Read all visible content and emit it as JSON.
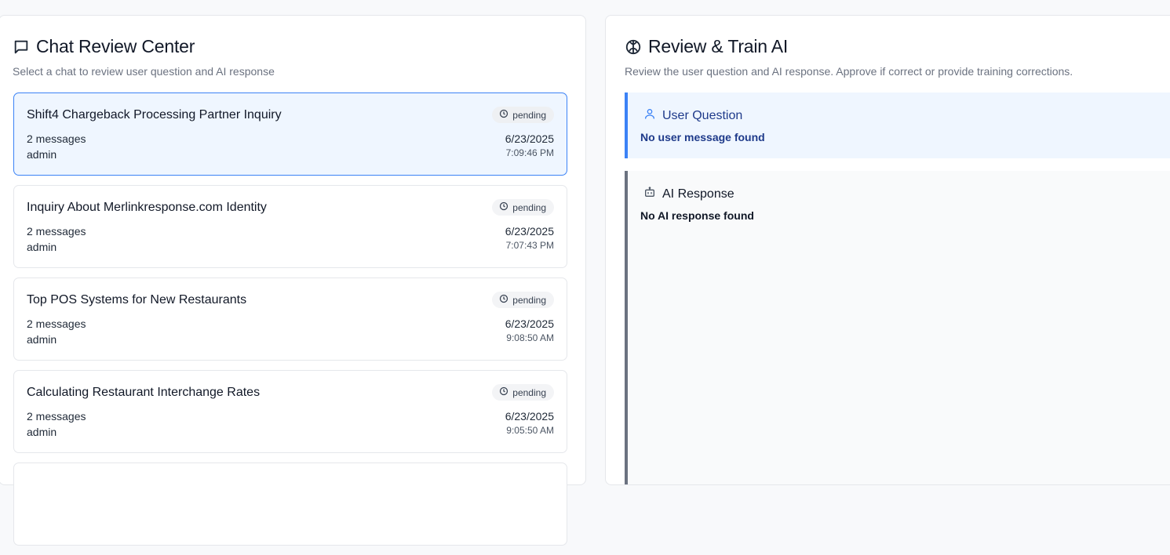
{
  "left_panel": {
    "title": "Chat Review Center",
    "subtitle": "Select a chat to review user question and AI response",
    "title_icon": "message-square-icon",
    "chats": [
      {
        "title": "Shift4 Chargeback Processing Partner Inquiry",
        "status": "pending",
        "messages": "2 messages",
        "user": "admin",
        "date": "6/23/2025",
        "time": "7:09:46 PM",
        "selected": true
      },
      {
        "title": "Inquiry About Merlinkresponse.com Identity",
        "status": "pending",
        "messages": "2 messages",
        "user": "admin",
        "date": "6/23/2025",
        "time": "7:07:43 PM",
        "selected": false
      },
      {
        "title": "Top POS Systems for New Restaurants",
        "status": "pending",
        "messages": "2 messages",
        "user": "admin",
        "date": "6/23/2025",
        "time": "9:08:50 AM",
        "selected": false
      },
      {
        "title": "Calculating Restaurant Interchange Rates",
        "status": "pending",
        "messages": "2 messages",
        "user": "admin",
        "date": "6/23/2025",
        "time": "9:05:50 AM",
        "selected": false
      }
    ]
  },
  "right_panel": {
    "title": "Review & Train AI",
    "subtitle": "Review the user question and AI response. Approve if correct or provide training corrections.",
    "title_icon": "brain-icon",
    "question": {
      "label": "User Question",
      "text": "No user message found",
      "icon": "user-icon"
    },
    "answer": {
      "label": "AI Response",
      "text": "No AI response found",
      "icon": "bot-icon"
    }
  },
  "colors": {
    "accent": "#3b82f6",
    "selected_bg": "#eff6ff",
    "question_text": "#1e3a8a",
    "answer_border": "#6b7280"
  }
}
